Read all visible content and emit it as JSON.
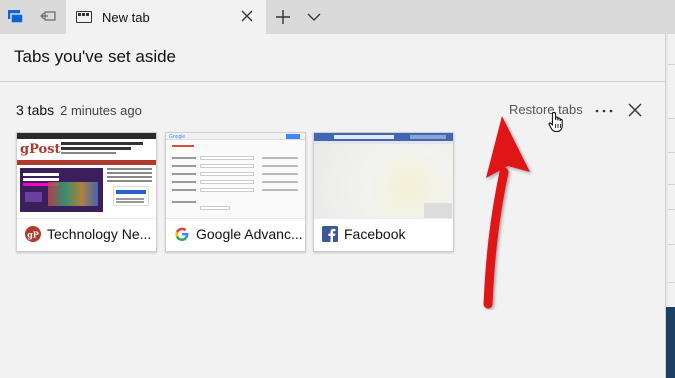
{
  "browser": {
    "active_tab": {
      "title": "New tab"
    }
  },
  "pane": {
    "title": "Tabs you've set aside",
    "group": {
      "count_label": "3 tabs",
      "age_label": "2 minutes ago",
      "restore_label": "Restore tabs",
      "more_label": "···"
    },
    "cards": [
      {
        "title": "Technology Ne...",
        "favicon": "groovypost-icon",
        "thumbnail": {
          "logo": "gPost",
          "headline": "Start Download - Update (Windows®) 10 Drivers",
          "promo_title": "Hollywood hits. On the house.",
          "brand": "Roku",
          "button": "Start Download"
        }
      },
      {
        "title": "Google Advanc...",
        "favicon": "google-icon",
        "thumbnail": {
          "logo": "Google",
          "heading": "Advanced Search"
        }
      },
      {
        "title": "Facebook",
        "favicon": "facebook-icon",
        "thumbnail": {}
      }
    ]
  },
  "colors": {
    "accent_red": "#e01919",
    "window_blue": "#1c3f66",
    "edge_blue": "#0a64d2",
    "facebook_blue": "#4267b2",
    "groovypost_red": "#b03a2e"
  }
}
